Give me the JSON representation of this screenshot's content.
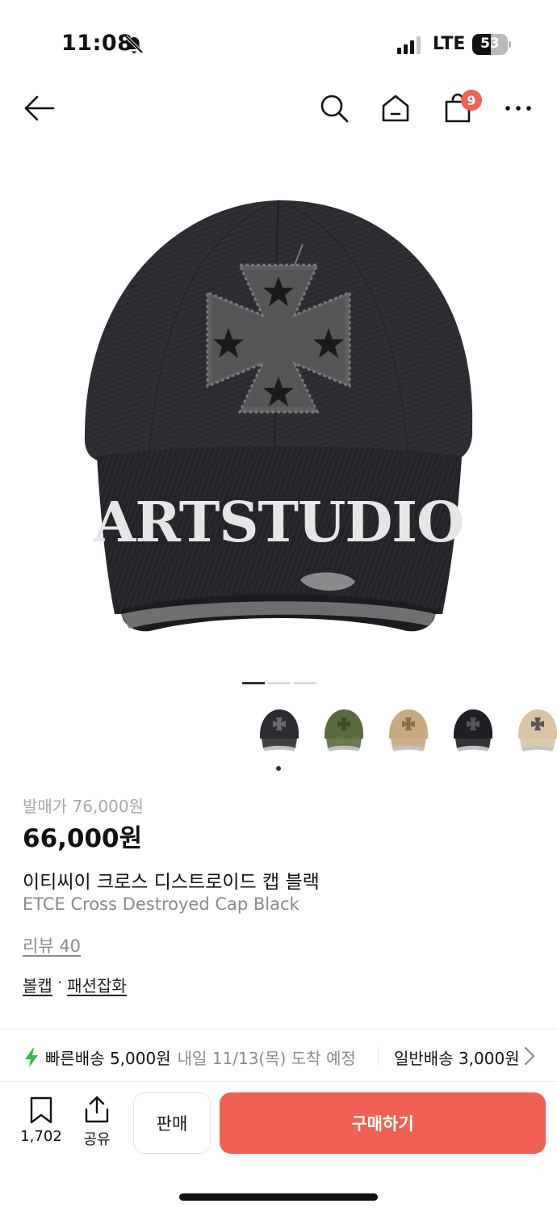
{
  "status_bar": {
    "time": "11:08",
    "network": "LTE",
    "battery": "53",
    "battery_level": 0.53
  },
  "nav": {
    "cart_count": "9",
    "icons": [
      "back-arrow-icon",
      "search-icon",
      "home-icon",
      "cart-icon",
      "more-icon"
    ]
  },
  "hero": {
    "embroidery_text": "ARTSTUDIO",
    "page_count": 3,
    "active_page": 1
  },
  "thumbnails": [
    {
      "variant": "black",
      "color": "#2a2c31",
      "patch": "#6b6b6b"
    },
    {
      "variant": "olive",
      "color": "#5b6b3f",
      "patch": "#3d4a2a"
    },
    {
      "variant": "beige-distressed",
      "color": "#c9a97f",
      "patch": "#8a6c4c"
    },
    {
      "variant": "black-2",
      "color": "#1d1f24",
      "patch": "#555"
    },
    {
      "variant": "beige",
      "color": "#d8c4a4",
      "patch": "#5a5550"
    }
  ],
  "product": {
    "release_price": "발매가 76,000원",
    "price": "66,000원",
    "name_ko": "이티씨이 크로스 디스트로이드 캡 블랙",
    "name_en": "ETCE Cross Destroyed Cap Black",
    "review": "리뷰 40",
    "category": [
      "볼캡",
      "패션잡화"
    ],
    "category_separator": "·"
  },
  "shipping": {
    "fast_label": "빠른배송 5,000원",
    "fast_date": "내일 11/13(목) 도착 예정",
    "normal_label": "일반배송 3,000원"
  },
  "actions": {
    "bookmark_count": "1,702",
    "share_label": "공유",
    "sell_label": "판매",
    "buy_label": "구매하기"
  },
  "colors": {
    "accent": "#ef6253",
    "bolt": "#2fbf4a",
    "muted_text": "#8a8a8a"
  }
}
